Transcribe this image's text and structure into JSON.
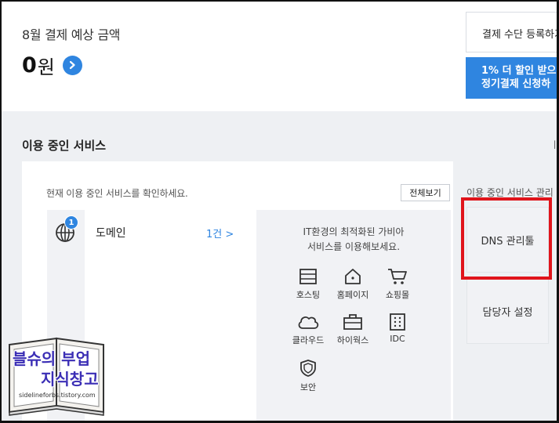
{
  "billing": {
    "month_label": "8월 결제 예상 금액",
    "amount": "0",
    "amount_unit": "원",
    "register_payment_label": "결제 수단 등록하기",
    "discount_line1": "1% 더 할인 받으",
    "discount_line2": "정기결제 신청하"
  },
  "services": {
    "section_title": "이용 중인 서비스",
    "right_edge_text": "ㅣ",
    "description": "현재 이용 중인 서비스를 확인하세요.",
    "view_all_label": "전체보기",
    "domain": {
      "label": "도메인",
      "badge": "1",
      "count": "1건 >"
    },
    "promo": {
      "line1": "IT환경의 최적화된 가비아",
      "line2": "서비스를 이용해보세요.",
      "items": [
        {
          "label": "호스팅",
          "icon": "hosting-icon"
        },
        {
          "label": "홈페이지",
          "icon": "homepage-icon"
        },
        {
          "label": "쇼핑몰",
          "icon": "cart-icon"
        },
        {
          "label": "클라우드",
          "icon": "cloud-icon"
        },
        {
          "label": "하이웍스",
          "icon": "briefcase-icon"
        },
        {
          "label": "IDC",
          "icon": "server-icon"
        },
        {
          "label": "보안",
          "icon": "shield-icon"
        }
      ]
    }
  },
  "management": {
    "label": "이용 중인 서비스 관리",
    "dns_label": "DNS 관리툴",
    "contact_label": "담당자 설정"
  },
  "watermark": {
    "line1": "블슈의 부업",
    "line2": "지식창고",
    "url": "sidelineforbs.tistory.com"
  },
  "colors": {
    "accent": "#2f85e0",
    "highlight": "#e0141b"
  }
}
